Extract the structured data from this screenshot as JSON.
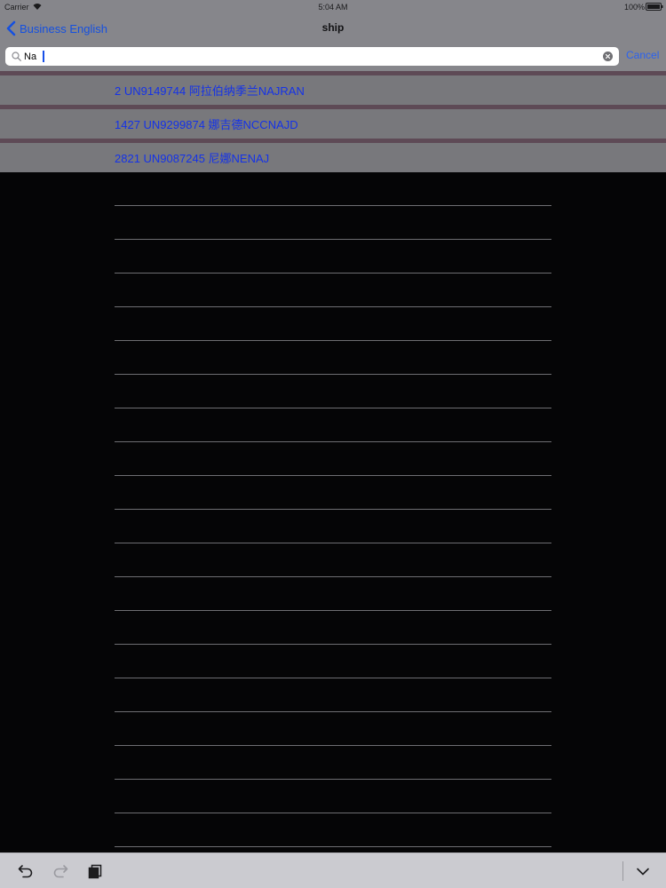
{
  "status_bar": {
    "carrier": "Carrier",
    "time": "5:04 AM",
    "battery": "100%"
  },
  "nav_bar": {
    "back_label": "Business English",
    "title": "ship"
  },
  "search": {
    "value": "Na",
    "cancel_label": "Cancel"
  },
  "results": [
    "2 UN9149744 阿拉伯纳季兰NAJRAN",
    "1427 UN9299874 娜吉德NCCNAJD",
    "2821 UN9087245 尼娜NENAJ"
  ],
  "icons": {
    "back": "chevron-left-icon",
    "search": "magnifier-icon",
    "clear": "clear-x-icon",
    "undo": "undo-icon",
    "redo": "redo-icon",
    "paste": "paste-icon",
    "dismiss": "chevron-down-icon"
  },
  "colors": {
    "accent": "#1550e0",
    "result_text": "#1432e8",
    "dim_overlay": "#86868b",
    "background": "#050506"
  }
}
